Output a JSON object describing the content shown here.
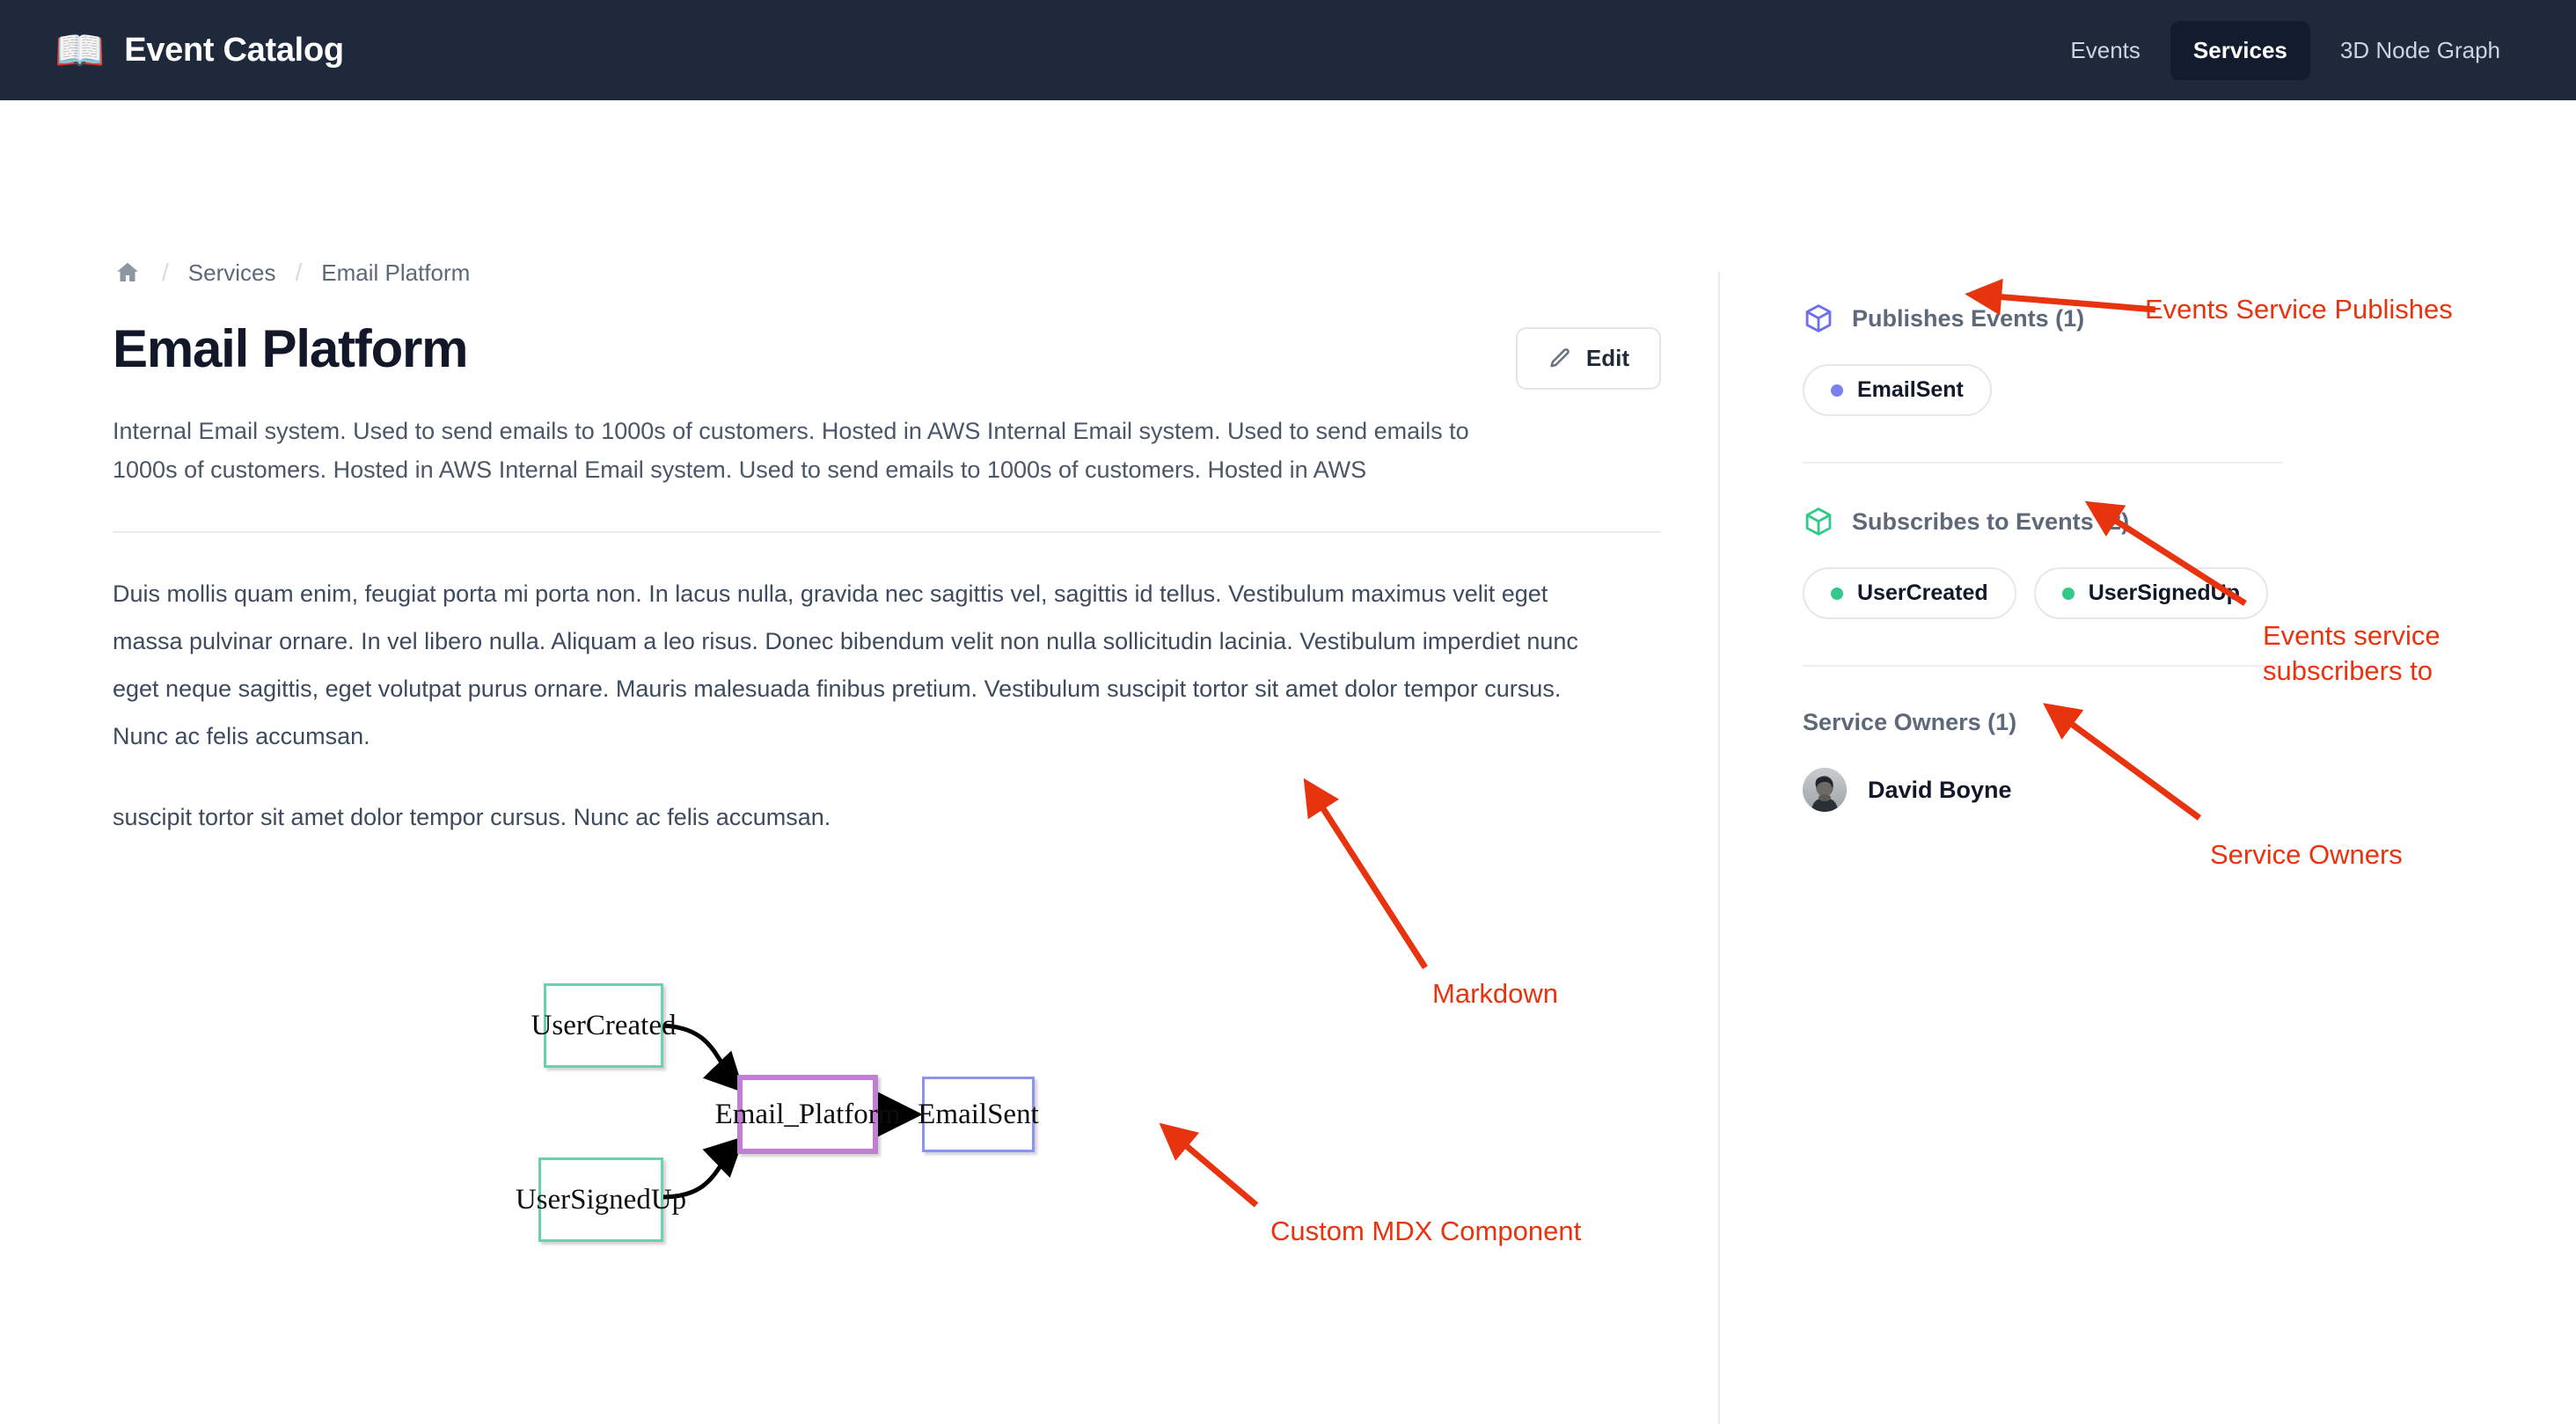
{
  "header": {
    "brand_icon": "open-book-icon",
    "brand_title": "Event Catalog",
    "nav": [
      {
        "label": "Events",
        "active": false
      },
      {
        "label": "Services",
        "active": true
      },
      {
        "label": "3D Node Graph",
        "active": false
      }
    ]
  },
  "breadcrumb": {
    "home_icon": "home-icon",
    "separator": "/",
    "items": [
      {
        "label": "Services"
      },
      {
        "label": "Email Platform"
      }
    ]
  },
  "page": {
    "title": "Email Platform",
    "edit_label": "Edit",
    "edit_icon": "pencil-icon",
    "description": "Internal Email system. Used to send emails to 1000s of customers. Hosted in AWS Internal Email system. Used to send emails to 1000s of customers. Hosted in AWS Internal Email system. Used to send emails to 1000s of customers. Hosted in AWS",
    "body_paragraph_1": "Duis mollis quam enim, feugiat porta mi porta non. In lacus nulla, gravida nec sagittis vel, sagittis id tellus. Vestibulum maximus velit eget massa pulvinar ornare. In vel libero nulla. Aliquam a leo risus. Donec bibendum velit non nulla sollicitudin lacinia. Vestibulum imperdiet nunc eget neque sagittis, eget volutpat purus ornare. Mauris malesuada finibus pretium. Vestibulum suscipit tortor sit amet dolor tempor cursus. Nunc ac felis accumsan.",
    "body_paragraph_2": "suscipit tortor sit amet dolor tempor cursus. Nunc ac felis accumsan."
  },
  "diagram": {
    "nodes": [
      {
        "id": "user-created",
        "label": "UserCreated",
        "color": "green"
      },
      {
        "id": "user-signed-up",
        "label": "UserSignedUp",
        "color": "green"
      },
      {
        "id": "email-platform",
        "label": "Email_Platform",
        "color": "purple"
      },
      {
        "id": "email-sent",
        "label": "EmailSent",
        "color": "blue"
      }
    ],
    "colors": {
      "green": "#6ad0ad",
      "purple": "#c07fd4",
      "blue": "#8b93f0"
    }
  },
  "sidebar": {
    "publishes": {
      "icon": "cube-icon",
      "icon_color": "#6c6ff0",
      "title": "Publishes Events (1)",
      "pills": [
        {
          "label": "EmailSent",
          "dot_color": "#7b7ff2"
        }
      ]
    },
    "subscribes": {
      "icon": "cube-icon",
      "icon_color": "#34c88a",
      "title": "Subscribes to Events (2)",
      "pills": [
        {
          "label": "UserCreated",
          "dot_color": "#34c88a"
        },
        {
          "label": "UserSignedUp",
          "dot_color": "#34c88a"
        }
      ]
    },
    "owners": {
      "title": "Service Owners (1)",
      "people": [
        {
          "name": "David Boyne",
          "avatar": "avatar-image"
        }
      ]
    }
  },
  "annotations": {
    "color": "#e8330f",
    "items": [
      {
        "id": "events-service-publishes",
        "text": "Events Service Publishes"
      },
      {
        "id": "events-service-subscribers-to",
        "text": "Events service\nsubscribers to"
      },
      {
        "id": "service-owners",
        "text": "Service Owners"
      },
      {
        "id": "markdown",
        "text": "Markdown"
      },
      {
        "id": "custom-mdx-component",
        "text": "Custom MDX Component"
      }
    ]
  }
}
